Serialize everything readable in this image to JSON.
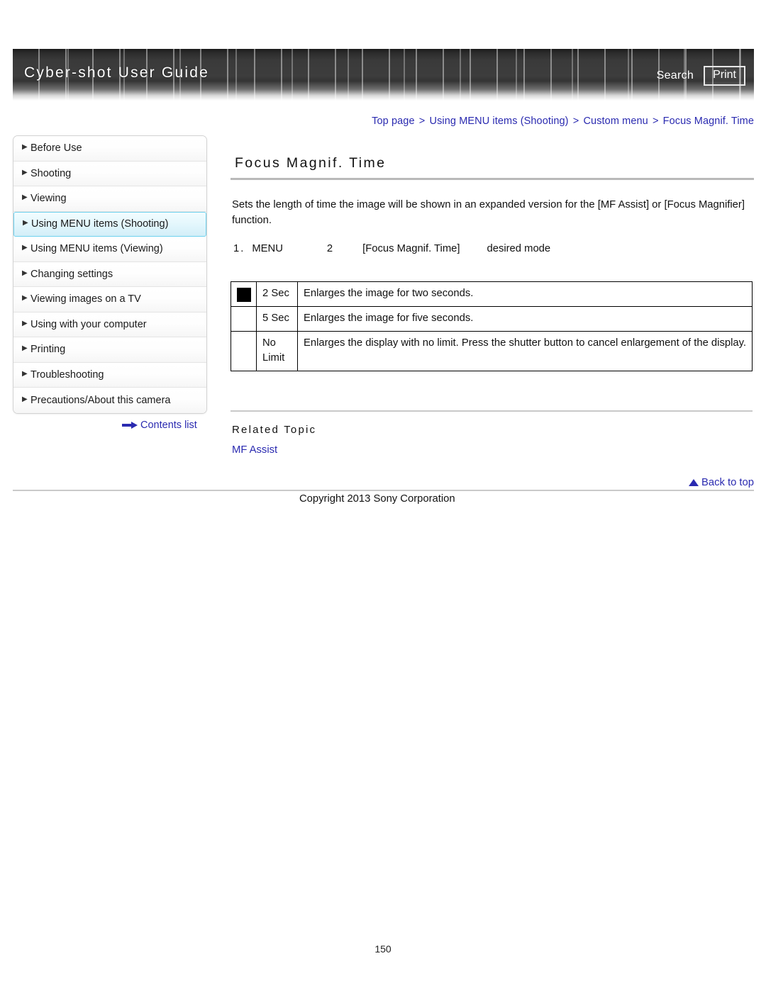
{
  "banner": {
    "title": "Cyber-shot User Guide",
    "search_label": "Search",
    "print_label": "Print"
  },
  "breadcrumb": {
    "separator": ">",
    "items": [
      "Top page",
      "Using MENU items (Shooting)",
      "Custom menu",
      "Focus Magnif. Time"
    ]
  },
  "sidebar": {
    "items": [
      {
        "label": "Before Use",
        "active": false
      },
      {
        "label": "Shooting",
        "active": false
      },
      {
        "label": "Viewing",
        "active": false
      },
      {
        "label": "Using MENU items (Shooting)",
        "active": true
      },
      {
        "label": "Using MENU items (Viewing)",
        "active": false
      },
      {
        "label": "Changing settings",
        "active": false
      },
      {
        "label": "Viewing images on a TV",
        "active": false
      },
      {
        "label": "Using with your computer",
        "active": false
      },
      {
        "label": "Printing",
        "active": false
      },
      {
        "label": "Troubleshooting",
        "active": false
      },
      {
        "label": "Precautions/About this camera",
        "active": false
      }
    ],
    "contents_list_label": "Contents list"
  },
  "main": {
    "title": "Focus Magnif. Time",
    "intro": "Sets the length of time the image will be shown in an expanded version for the [MF Assist] or [Focus Magnifier] function.",
    "steps": {
      "step1_num": "1.",
      "step1_label": "MENU",
      "step2_num": "2",
      "step2_label": "[Focus Magnif. Time]",
      "step3_label": "desired mode"
    },
    "options": [
      {
        "selected": true,
        "name": "2 Sec",
        "description": "Enlarges the image for two seconds."
      },
      {
        "selected": false,
        "name": "5 Sec",
        "description": "Enlarges the image for five seconds."
      },
      {
        "selected": false,
        "name": "No Limit",
        "description": "Enlarges the display with no limit. Press the shutter button to cancel enlargement of the display."
      }
    ],
    "related_heading": "Related Topic",
    "related_links": [
      "MF Assist"
    ]
  },
  "footer": {
    "back_to_top_label": "Back to top",
    "copyright": "Copyright 2013 Sony Corporation",
    "page_number": "150"
  },
  "colors": {
    "link": "#2a2ab0",
    "active_nav_border": "#6fd2ef",
    "rule": "#c9c9c9"
  }
}
